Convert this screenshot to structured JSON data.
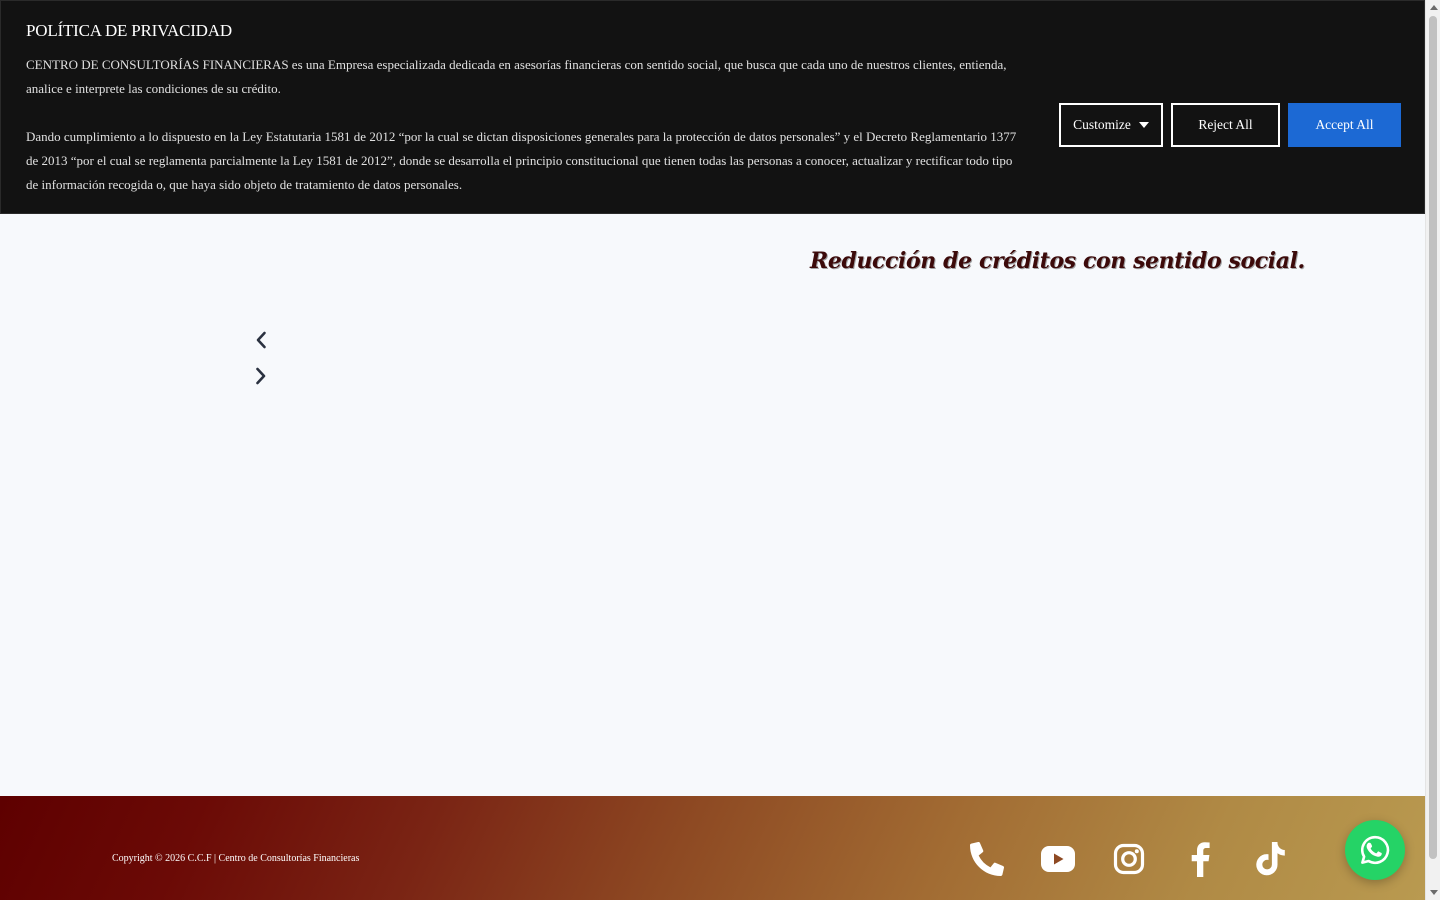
{
  "cookie_banner": {
    "title": "POLÍTICA DE PRIVACIDAD",
    "paragraph_1": "CENTRO DE CONSULTORÍAS FINANCIERAS es una Empresa especializada dedicada en asesorías financieras con sentido social, que busca que cada uno de nuestros clientes, entienda, analice e interprete las condiciones de su crédito.",
    "paragraph_2": "Dando cumplimiento a lo dispuesto en la Ley Estatutaria 1581 de 2012 “por la cual se dictan disposiciones generales para la protección de datos personales” y el Decreto Reglamentario 1377 de 2013 “por el cual se reglamenta parcialmente la Ley 1581 de 2012”, donde se desarrolla el principio constitucional que tienen todas las personas a conocer, actualizar y rectificar todo tipo de información recogida o, que haya sido objeto de tratamiento de datos personales.",
    "buttons": {
      "customize": "Customize",
      "reject": "Reject All",
      "accept": "Accept All"
    },
    "colors": {
      "background": "#121212",
      "accept": "#1c69d4"
    }
  },
  "main": {
    "headline": "Reducción de créditos con sentido social.",
    "carousel": {
      "prev_icon": "chevron-left-icon",
      "next_icon": "chevron-right-icon"
    }
  },
  "footer": {
    "copyright": "Copyright © 2026 C.C.F | Centro de Consultorías Financieras",
    "social_icons": [
      "phone-icon",
      "youtube-icon",
      "instagram-icon",
      "facebook-icon",
      "tiktok-icon"
    ],
    "gradient": [
      "#5e0000",
      "#b99a50"
    ]
  },
  "floating": {
    "whatsapp_icon": "whatsapp-icon",
    "color": "#25d366"
  }
}
